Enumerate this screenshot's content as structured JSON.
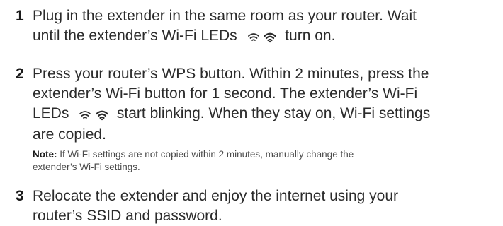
{
  "steps": [
    {
      "number": "1",
      "lines": [
        "Plug in the extender in the same room as your router. Wait",
        "until the extender’s Wi-Fi LEDs",
        "turn on."
      ]
    },
    {
      "number": "2",
      "lines": [
        "Press your router’s WPS button. Within 2 minutes, press the",
        "extender’s Wi-Fi button for 1 second. The extender’s Wi-Fi",
        "LEDs",
        "start blinking. When they stay on, Wi-Fi settings",
        "are copied."
      ],
      "note_label": "Note:",
      "note_lines": [
        "If Wi-Fi settings are not copied within 2 minutes, manually change the",
        "extender’s Wi-Fi settings."
      ]
    },
    {
      "number": "3",
      "lines": [
        "Relocate the extender and enjoy the internet using your",
        "router’s SSID and password."
      ]
    }
  ],
  "icons": [
    "wifi-2.4ghz-led-icon",
    "wifi-5ghz-led-icon"
  ]
}
